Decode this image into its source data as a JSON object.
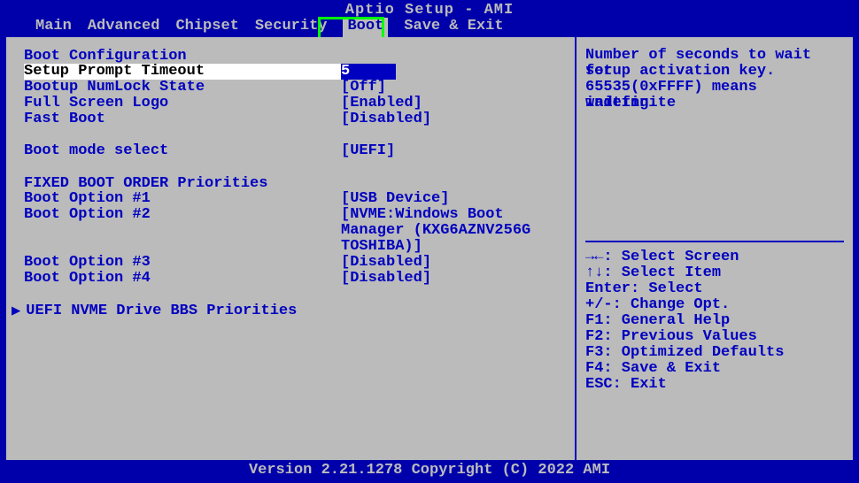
{
  "title": "Aptio Setup - AMI",
  "menu": {
    "items": [
      "Main",
      "Advanced",
      "Chipset",
      "Security",
      "Boot",
      "Save & Exit"
    ],
    "active_index": 4
  },
  "left": {
    "section1_title": "Boot Configuration",
    "rows1": [
      {
        "label": "Setup Prompt Timeout",
        "value": "5",
        "selected": true
      },
      {
        "label": "Bootup NumLock State",
        "value": "[Off]"
      },
      {
        "label": "Full Screen Logo",
        "value": "[Enabled]"
      },
      {
        "label": "Fast Boot",
        "value": "[Disabled]"
      }
    ],
    "rows2": [
      {
        "label": "Boot mode select",
        "value": "[UEFI]"
      }
    ],
    "section2_title": "FIXED BOOT ORDER Priorities",
    "rows3": [
      {
        "label": "Boot Option #1",
        "value": "[USB Device]"
      },
      {
        "label": "Boot Option #2",
        "value_lines": [
          "[NVME:Windows Boot",
          "Manager (KXG6AZNV256G",
          "TOSHIBA)]"
        ]
      },
      {
        "label": "Boot Option #3",
        "value": "[Disabled]"
      },
      {
        "label": "Boot Option #4",
        "value": "[Disabled]"
      }
    ],
    "submenu": "UEFI NVME Drive BBS Priorities"
  },
  "right": {
    "help_lines": [
      "Number of seconds to wait for",
      "setup activation key.",
      "65535(0xFFFF) means indefinite",
      "waiting."
    ],
    "keys": [
      "→←: Select Screen",
      "↑↓: Select Item",
      "Enter: Select",
      "+/-: Change Opt.",
      "F1: General Help",
      "F2: Previous Values",
      "F3: Optimized Defaults",
      "F4: Save & Exit",
      "ESC: Exit"
    ]
  },
  "footer": "Version 2.21.1278 Copyright (C) 2022 AMI"
}
